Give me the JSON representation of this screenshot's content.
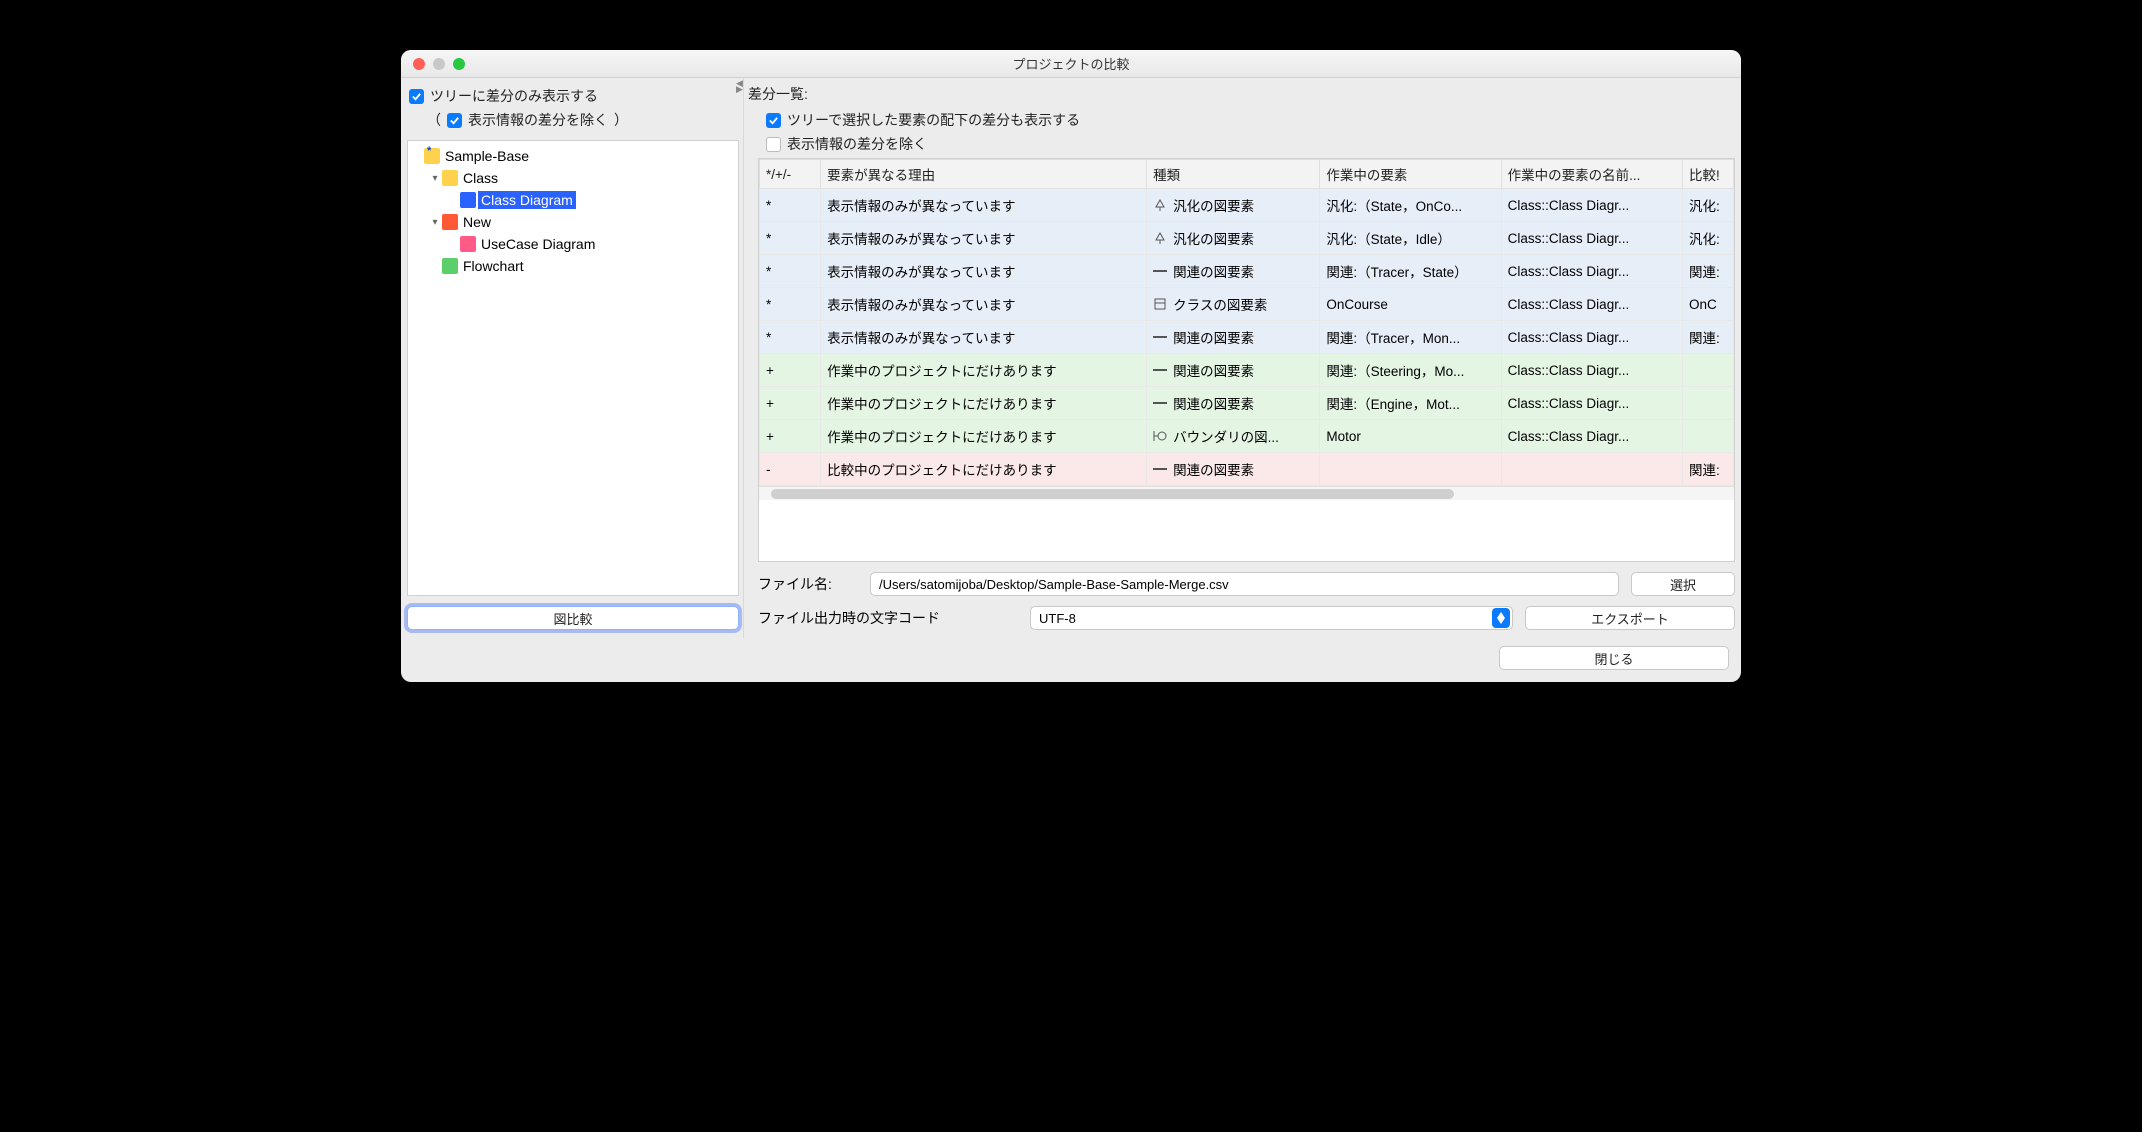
{
  "title": "プロジェクトの比較",
  "left": {
    "show_diff_only": "ツリーに差分のみ表示する",
    "exclude_display_prefix": "（",
    "exclude_display": "表示情報の差分を除く",
    "exclude_display_suffix": "）",
    "tree": [
      {
        "level": 0,
        "disclosure": "",
        "icon": "folder-star",
        "label": "Sample-Base"
      },
      {
        "level": 1,
        "disclosure": "v",
        "icon": "folder",
        "label": "Class"
      },
      {
        "level": 2,
        "disclosure": "",
        "icon": "classd",
        "label": "Class Diagram",
        "selected": true
      },
      {
        "level": 1,
        "disclosure": "v",
        "icon": "folder-minus",
        "label": "New"
      },
      {
        "level": 2,
        "disclosure": "",
        "icon": "usecase",
        "label": "UseCase Diagram"
      },
      {
        "level": 1,
        "disclosure": "",
        "icon": "flow",
        "label": "Flowchart"
      }
    ],
    "compare_button": "図比較"
  },
  "right": {
    "diff_list_label": "差分一覧:",
    "show_children": "ツリーで選択した要素の配下の差分も表示する",
    "exclude_display": "表示情報の差分を除く",
    "columns": [
      "*/+/-",
      "要素が異なる理由",
      "種類",
      "作業中の要素",
      "作業中の要素の名前...",
      "比較!"
    ],
    "col_widths": [
      "60px",
      "320px",
      "170px",
      "178px",
      "178px",
      "50px"
    ],
    "rows": [
      {
        "c": "blue",
        "mark": "*",
        "reason": "表示情報のみが異なっています",
        "kind": "汎化の図要素",
        "kind_icon": "gen",
        "el": "汎化:（State，OnCo...",
        "name": "Class::Class Diagr...",
        "cmp": "汎化:"
      },
      {
        "c": "blue",
        "mark": "*",
        "reason": "表示情報のみが異なっています",
        "kind": "汎化の図要素",
        "kind_icon": "gen",
        "el": "汎化:（State，Idle）",
        "name": "Class::Class Diagr...",
        "cmp": "汎化:"
      },
      {
        "c": "blue",
        "mark": "*",
        "reason": "表示情報のみが異なっています",
        "kind": "関連の図要素",
        "kind_icon": "assoc",
        "el": "関連:（Tracer，State）",
        "name": "Class::Class Diagr...",
        "cmp": "関連:"
      },
      {
        "c": "blue",
        "mark": "*",
        "reason": "表示情報のみが異なっています",
        "kind": "クラスの図要素",
        "kind_icon": "cls",
        "el": "OnCourse",
        "name": "Class::Class Diagr...",
        "cmp": "OnC"
      },
      {
        "c": "blue",
        "mark": "*",
        "reason": "表示情報のみが異なっています",
        "kind": "関連の図要素",
        "kind_icon": "assoc",
        "el": "関連:（Tracer，Mon...",
        "name": "Class::Class Diagr...",
        "cmp": "関連:"
      },
      {
        "c": "green",
        "mark": "+",
        "reason": "作業中のプロジェクトにだけあります",
        "kind": "関連の図要素",
        "kind_icon": "assoc",
        "el": "関連:（Steering，Mo...",
        "name": "Class::Class Diagr...",
        "cmp": ""
      },
      {
        "c": "green",
        "mark": "+",
        "reason": "作業中のプロジェクトにだけあります",
        "kind": "関連の図要素",
        "kind_icon": "assoc",
        "el": "関連:（Engine，Mot...",
        "name": "Class::Class Diagr...",
        "cmp": ""
      },
      {
        "c": "green",
        "mark": "+",
        "reason": "作業中のプロジェクトにだけあります",
        "kind": "バウンダリの図...",
        "kind_icon": "bound",
        "el": "Motor",
        "name": "Class::Class Diagr...",
        "cmp": ""
      },
      {
        "c": "red",
        "mark": "-",
        "reason": "比較中のプロジェクトにだけあります",
        "kind": "関連の図要素",
        "kind_icon": "assoc",
        "el": "",
        "name": "",
        "cmp": "関連:"
      }
    ],
    "file_label": "ファイル名:",
    "file_value": "/Users/satomijoba/Desktop/Sample-Base-Sample-Merge.csv",
    "select_button": "選択",
    "encoding_label": "ファイル出力時の文字コード",
    "encoding_value": "UTF-8",
    "export_button": "エクスポート",
    "close_button": "閉じる"
  }
}
